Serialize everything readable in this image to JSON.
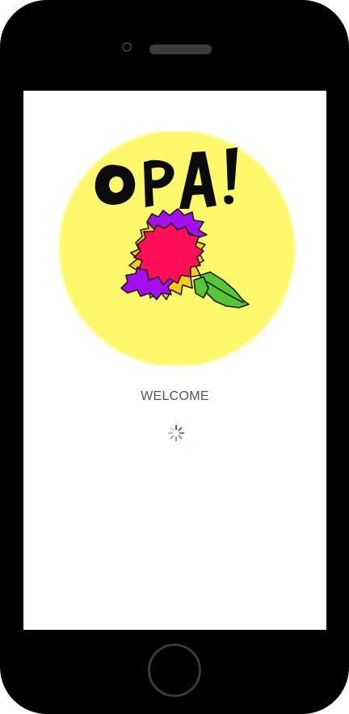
{
  "device": {
    "frame_color": "#000000",
    "accent_color": "#3a3a3a"
  },
  "splash": {
    "logo": {
      "text": "OPA!",
      "icon": "opa-carnation-logo",
      "circle_color": "#fdf96a"
    },
    "welcome_text": "WELCOME",
    "loader_icon": "loading-spinner-icon"
  }
}
